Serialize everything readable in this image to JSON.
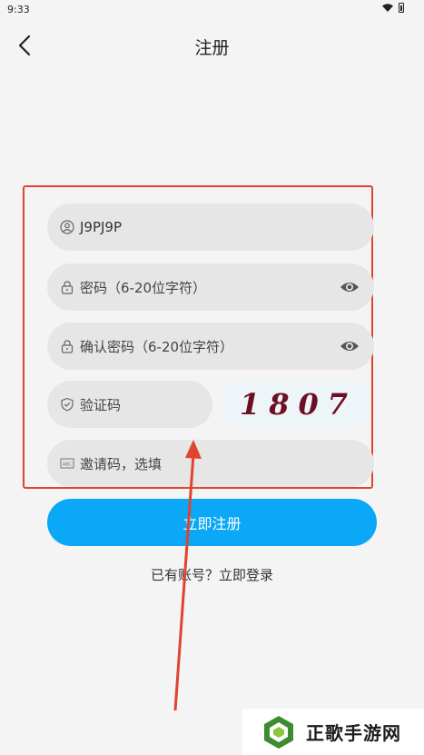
{
  "status_bar": {
    "time": "9:33"
  },
  "header": {
    "title": "注册"
  },
  "form": {
    "username": {
      "value": "J9PJ9P",
      "icon": "user-icon"
    },
    "password": {
      "placeholder": "密码（6-20位字符）",
      "icon": "lock-icon"
    },
    "confirm_password": {
      "placeholder": "确认密码（6-20位字符）",
      "icon": "lock-icon"
    },
    "verification_code": {
      "placeholder": "验证码",
      "icon": "shield-icon"
    },
    "captcha": {
      "text": "1807"
    },
    "invite_code": {
      "placeholder": "邀请码，选填",
      "icon": "abc-icon"
    }
  },
  "actions": {
    "register_label": "立即注册",
    "login_link": "已有账号？立即登录"
  },
  "watermark": {
    "text": "正歌手游网"
  },
  "colors": {
    "primary": "#0aa8f6",
    "annotation": "#e0442f",
    "background": "#f4f4f4",
    "field": "#e6e6e6"
  }
}
